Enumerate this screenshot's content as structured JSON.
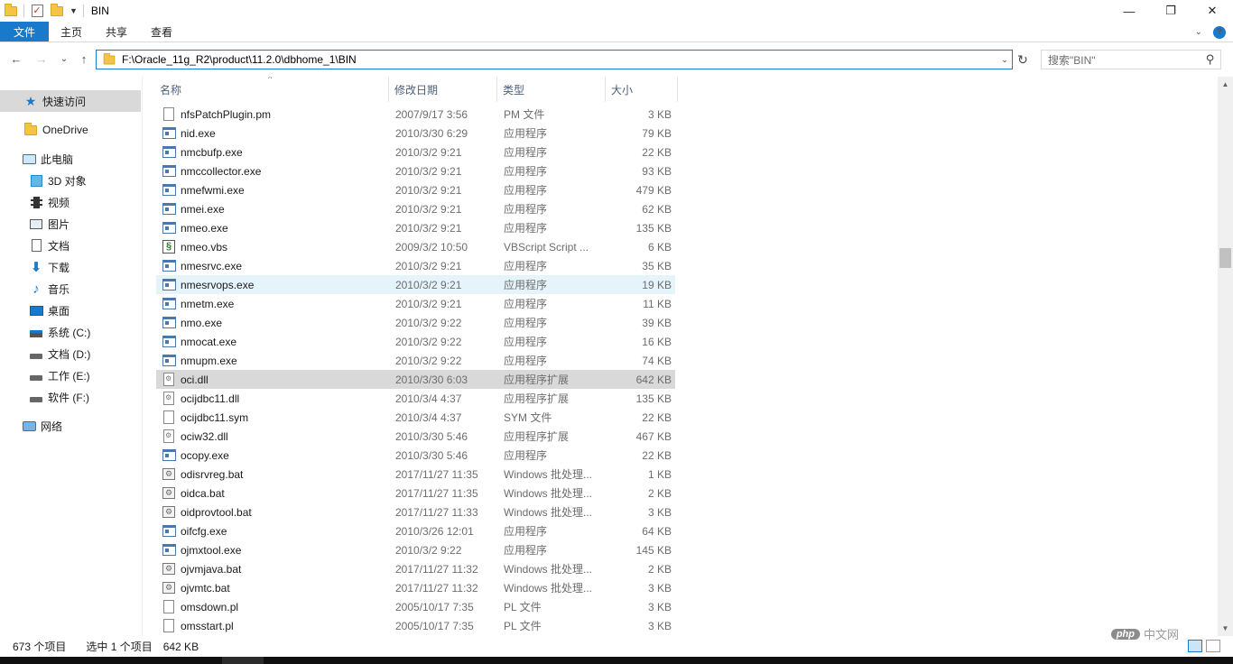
{
  "window": {
    "title": "BIN",
    "controls": {
      "minimize": "—",
      "maximize": "❐",
      "close": "✕"
    }
  },
  "ribbon": {
    "tabs": [
      "文件",
      "主页",
      "共享",
      "查看"
    ],
    "expand_glyph": "⌄",
    "help_glyph": "?"
  },
  "address": {
    "path": "F:\\Oracle_11g_R2\\product\\11.2.0\\dbhome_1\\BIN",
    "back": "←",
    "forward": "→",
    "recent": "⌄",
    "up": "↑",
    "refresh": "↻",
    "dropdown": "⌄"
  },
  "search": {
    "placeholder": "搜索\"BIN\"",
    "icon": "⚲"
  },
  "nav_pane": {
    "items": [
      {
        "label": "快速访问",
        "icon": "star-icon",
        "indent": 0,
        "selected": true
      },
      {
        "label": "OneDrive",
        "icon": "folder-icon",
        "indent": 0
      },
      {
        "label": "此电脑",
        "icon": "computer-icon",
        "indent": 0
      },
      {
        "label": "3D 对象",
        "icon": "cube-icon",
        "indent": 1
      },
      {
        "label": "视频",
        "icon": "video-icon",
        "indent": 1
      },
      {
        "label": "图片",
        "icon": "picture-icon",
        "indent": 1
      },
      {
        "label": "文档",
        "icon": "document-icon",
        "indent": 1
      },
      {
        "label": "下载",
        "icon": "download-icon",
        "indent": 1
      },
      {
        "label": "音乐",
        "icon": "music-icon",
        "indent": 1
      },
      {
        "label": "桌面",
        "icon": "desktop-icon",
        "indent": 1
      },
      {
        "label": "系统 (C:)",
        "icon": "system-drive-icon",
        "indent": 1
      },
      {
        "label": "文档 (D:)",
        "icon": "drive-icon",
        "indent": 1
      },
      {
        "label": "工作 (E:)",
        "icon": "drive-icon",
        "indent": 1
      },
      {
        "label": "软件 (F:)",
        "icon": "drive-icon",
        "indent": 1
      },
      {
        "label": "网络",
        "icon": "network-icon",
        "indent": 0
      }
    ]
  },
  "file_list": {
    "columns": {
      "name": "名称",
      "date": "修改日期",
      "type": "类型",
      "size": "大小"
    },
    "sort_glyph": "^",
    "rows": [
      {
        "name": "nfsPatchPlugin.pm",
        "date": "2007/9/17 3:56",
        "type": "PM 文件",
        "size": "3 KB",
        "icon": "file-icon"
      },
      {
        "name": "nid.exe",
        "date": "2010/3/30 6:29",
        "type": "应用程序",
        "size": "79 KB",
        "icon": "exe-icon"
      },
      {
        "name": "nmcbufp.exe",
        "date": "2010/3/2 9:21",
        "type": "应用程序",
        "size": "22 KB",
        "icon": "exe-icon"
      },
      {
        "name": "nmccollector.exe",
        "date": "2010/3/2 9:21",
        "type": "应用程序",
        "size": "93 KB",
        "icon": "exe-icon"
      },
      {
        "name": "nmefwmi.exe",
        "date": "2010/3/2 9:21",
        "type": "应用程序",
        "size": "479 KB",
        "icon": "exe-icon"
      },
      {
        "name": "nmei.exe",
        "date": "2010/3/2 9:21",
        "type": "应用程序",
        "size": "62 KB",
        "icon": "exe-icon"
      },
      {
        "name": "nmeo.exe",
        "date": "2010/3/2 9:21",
        "type": "应用程序",
        "size": "135 KB",
        "icon": "exe-icon"
      },
      {
        "name": "nmeo.vbs",
        "date": "2009/3/2 10:50",
        "type": "VBScript Script ...",
        "size": "6 KB",
        "icon": "vbs-icon"
      },
      {
        "name": "nmesrvc.exe",
        "date": "2010/3/2 9:21",
        "type": "应用程序",
        "size": "35 KB",
        "icon": "exe-icon"
      },
      {
        "name": "nmesrvops.exe",
        "date": "2010/3/2 9:21",
        "type": "应用程序",
        "size": "19 KB",
        "icon": "exe-icon",
        "state": "hover"
      },
      {
        "name": "nmetm.exe",
        "date": "2010/3/2 9:21",
        "type": "应用程序",
        "size": "11 KB",
        "icon": "exe-icon"
      },
      {
        "name": "nmo.exe",
        "date": "2010/3/2 9:22",
        "type": "应用程序",
        "size": "39 KB",
        "icon": "exe-icon"
      },
      {
        "name": "nmocat.exe",
        "date": "2010/3/2 9:22",
        "type": "应用程序",
        "size": "16 KB",
        "icon": "exe-icon"
      },
      {
        "name": "nmupm.exe",
        "date": "2010/3/2 9:22",
        "type": "应用程序",
        "size": "74 KB",
        "icon": "exe-icon"
      },
      {
        "name": "oci.dll",
        "date": "2010/3/30 6:03",
        "type": "应用程序扩展",
        "size": "642 KB",
        "icon": "dll-icon",
        "state": "selected"
      },
      {
        "name": "ocijdbc11.dll",
        "date": "2010/3/4 4:37",
        "type": "应用程序扩展",
        "size": "135 KB",
        "icon": "dll-icon"
      },
      {
        "name": "ocijdbc11.sym",
        "date": "2010/3/4 4:37",
        "type": "SYM 文件",
        "size": "22 KB",
        "icon": "file-icon"
      },
      {
        "name": "ociw32.dll",
        "date": "2010/3/30 5:46",
        "type": "应用程序扩展",
        "size": "467 KB",
        "icon": "dll-icon"
      },
      {
        "name": "ocopy.exe",
        "date": "2010/3/30 5:46",
        "type": "应用程序",
        "size": "22 KB",
        "icon": "exe-icon"
      },
      {
        "name": "odisrvreg.bat",
        "date": "2017/11/27 11:35",
        "type": "Windows 批处理...",
        "size": "1 KB",
        "icon": "bat-icon"
      },
      {
        "name": "oidca.bat",
        "date": "2017/11/27 11:35",
        "type": "Windows 批处理...",
        "size": "2 KB",
        "icon": "bat-icon"
      },
      {
        "name": "oidprovtool.bat",
        "date": "2017/11/27 11:33",
        "type": "Windows 批处理...",
        "size": "3 KB",
        "icon": "bat-icon"
      },
      {
        "name": "oifcfg.exe",
        "date": "2010/3/26 12:01",
        "type": "应用程序",
        "size": "64 KB",
        "icon": "exe-icon"
      },
      {
        "name": "ojmxtool.exe",
        "date": "2010/3/2 9:22",
        "type": "应用程序",
        "size": "145 KB",
        "icon": "exe-icon"
      },
      {
        "name": "ojvmjava.bat",
        "date": "2017/11/27 11:32",
        "type": "Windows 批处理...",
        "size": "2 KB",
        "icon": "bat-icon"
      },
      {
        "name": "ojvmtc.bat",
        "date": "2017/11/27 11:32",
        "type": "Windows 批处理...",
        "size": "3 KB",
        "icon": "bat-icon"
      },
      {
        "name": "omsdown.pl",
        "date": "2005/10/17 7:35",
        "type": "PL 文件",
        "size": "3 KB",
        "icon": "file-icon"
      },
      {
        "name": "omsstart.pl",
        "date": "2005/10/17 7:35",
        "type": "PL 文件",
        "size": "3 KB",
        "icon": "file-icon"
      }
    ]
  },
  "scrollbar": {
    "up": "▲",
    "down": "▼"
  },
  "status": {
    "item_count": "673 个项目",
    "selected": "选中 1 个项目",
    "selected_size": "642 KB"
  },
  "watermark": {
    "logo": "php",
    "text": "中文网"
  },
  "colors": {
    "accent": "#1979ca",
    "selected_row": "#d9d9d9",
    "hover_row": "#e5f3fb"
  }
}
